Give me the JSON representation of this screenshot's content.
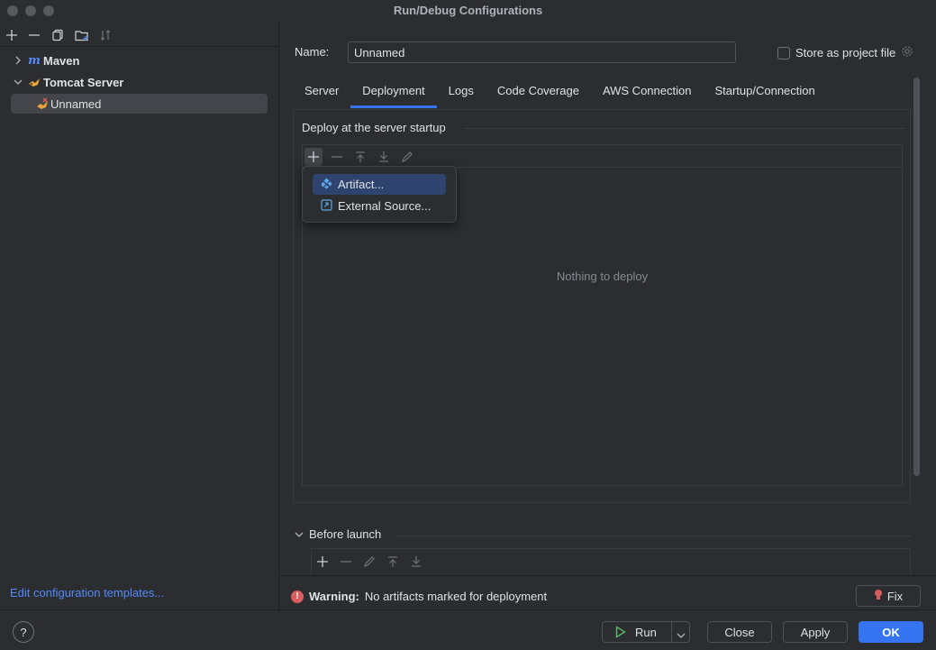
{
  "window": {
    "title": "Run/Debug Configurations"
  },
  "left": {
    "toolbar": [
      "add-icon",
      "remove-icon",
      "copy-icon",
      "folder-icon",
      "sort-icon"
    ],
    "tree": [
      {
        "label": "Maven",
        "icon": "maven-icon",
        "expanded": false
      },
      {
        "label": "Tomcat Server",
        "icon": "tomcat-icon",
        "expanded": true
      },
      {
        "label": "Unnamed",
        "icon": "tomcat-error-icon",
        "selected": true
      }
    ],
    "edit_templates": "Edit configuration templates..."
  },
  "config": {
    "name_label": "Name:",
    "name_value": "Unnamed",
    "store_label": "Store as project file",
    "store_checked": false
  },
  "tabs": [
    "Server",
    "Deployment",
    "Logs",
    "Code Coverage",
    "AWS Connection",
    "Startup/Connection"
  ],
  "active_tab": "Deployment",
  "deploy": {
    "section_title": "Deploy at the server startup",
    "empty_text": "Nothing to deploy",
    "popup": [
      {
        "label": "Artifact...",
        "icon": "artifact-icon",
        "selected": true
      },
      {
        "label": "External Source...",
        "icon": "external-source-icon",
        "selected": false
      }
    ]
  },
  "before_launch": {
    "title": "Before launch"
  },
  "warning": {
    "prefix": "Warning:",
    "text": "No artifacts marked for deployment",
    "fix_label": "Fix"
  },
  "footer": {
    "help": "?",
    "run": "Run",
    "close": "Close",
    "apply": "Apply",
    "ok": "OK"
  },
  "colors": {
    "accent": "#3574f0",
    "link": "#548af7",
    "error": "#db5c5c",
    "background": "#2b2d30"
  }
}
